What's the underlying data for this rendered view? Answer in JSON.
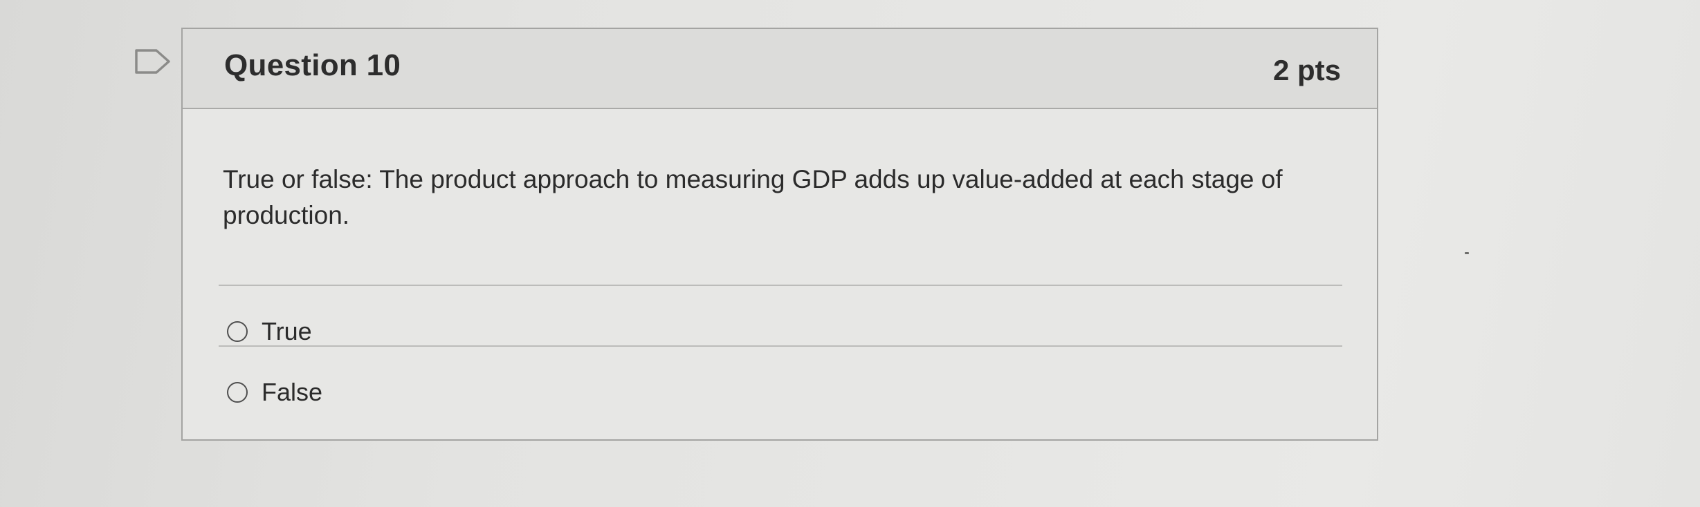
{
  "question": {
    "title": "Question 10",
    "points": "2 pts",
    "text": "True or false: The product approach to measuring GDP adds up value-added at each stage of production.",
    "answers": [
      {
        "label": "True",
        "selected": false
      },
      {
        "label": "False",
        "selected": false
      }
    ]
  },
  "icons": {
    "flag": "flag-question-icon",
    "radio": "radio-button-icon"
  },
  "colors": {
    "background": "#e6e6e4",
    "header_background": "#dcdcda",
    "border": "#a4a4a2",
    "text": "#2b2b2b"
  }
}
